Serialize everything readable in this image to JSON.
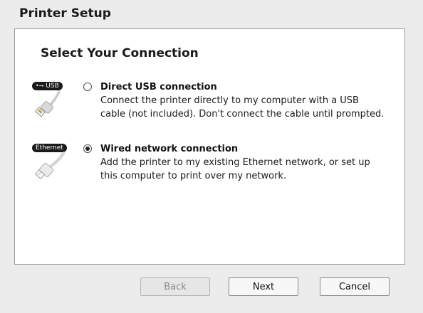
{
  "window": {
    "title": "Printer Setup"
  },
  "panel": {
    "heading": "Select Your Connection",
    "options": [
      {
        "icon": "usb-cable-icon",
        "badge": "USB",
        "label": "Direct USB connection",
        "description_line1": "Connect the printer directly to my computer with a USB",
        "description_line2": "cable (not included). Don't connect the cable until prompted.",
        "selected": false
      },
      {
        "icon": "ethernet-cable-icon",
        "badge": "Ethernet",
        "label": "Wired network connection",
        "description_line1": "Add the printer to my existing Ethernet network, or set up",
        "description_line2": "this computer to print over my network.",
        "selected": true
      }
    ]
  },
  "buttons": {
    "back": "Back",
    "next": "Next",
    "cancel": "Cancel"
  }
}
